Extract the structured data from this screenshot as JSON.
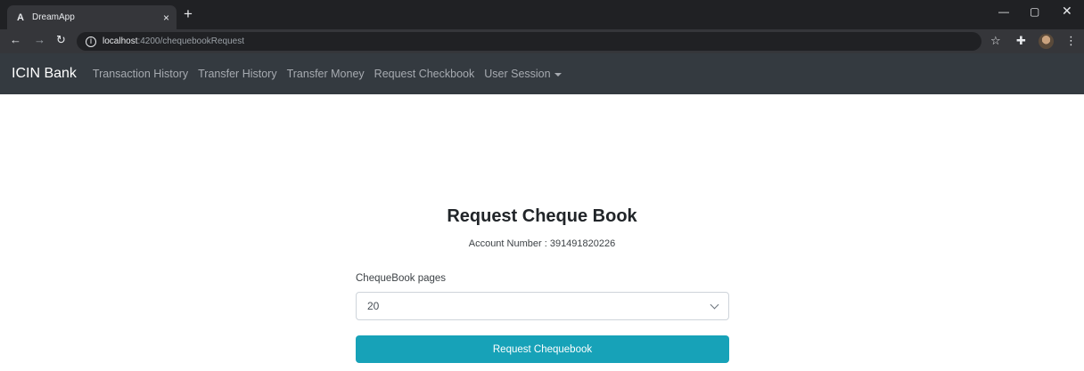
{
  "browser": {
    "tab_favicon": "A",
    "tab_title": "DreamApp",
    "tab_close": "×",
    "new_tab": "+",
    "url_host": "localhost",
    "url_rest": ":4200/chequebookRequest",
    "icons": [
      "back-arrow-icon",
      "forward-arrow-icon",
      "reload-icon",
      "info-icon",
      "star-icon",
      "extensions-icon",
      "avatar",
      "kebab-menu-icon",
      "minimize-icon",
      "restore-icon",
      "close-icon"
    ]
  },
  "navbar": {
    "brand": "ICIN Bank",
    "links": [
      "Transaction History",
      "Transfer History",
      "Transfer Money",
      "Request Checkbook",
      "User Session"
    ]
  },
  "form": {
    "title": "Request Cheque Book",
    "account_text": "Account Number : 391491820226",
    "pages_label": "ChequeBook pages",
    "pages_value": "20",
    "submit_label": "Request Chequebook"
  },
  "colors": {
    "navbar_bg": "#343a40",
    "button_bg": "#17a2b8",
    "browser_frame": "#202124"
  }
}
